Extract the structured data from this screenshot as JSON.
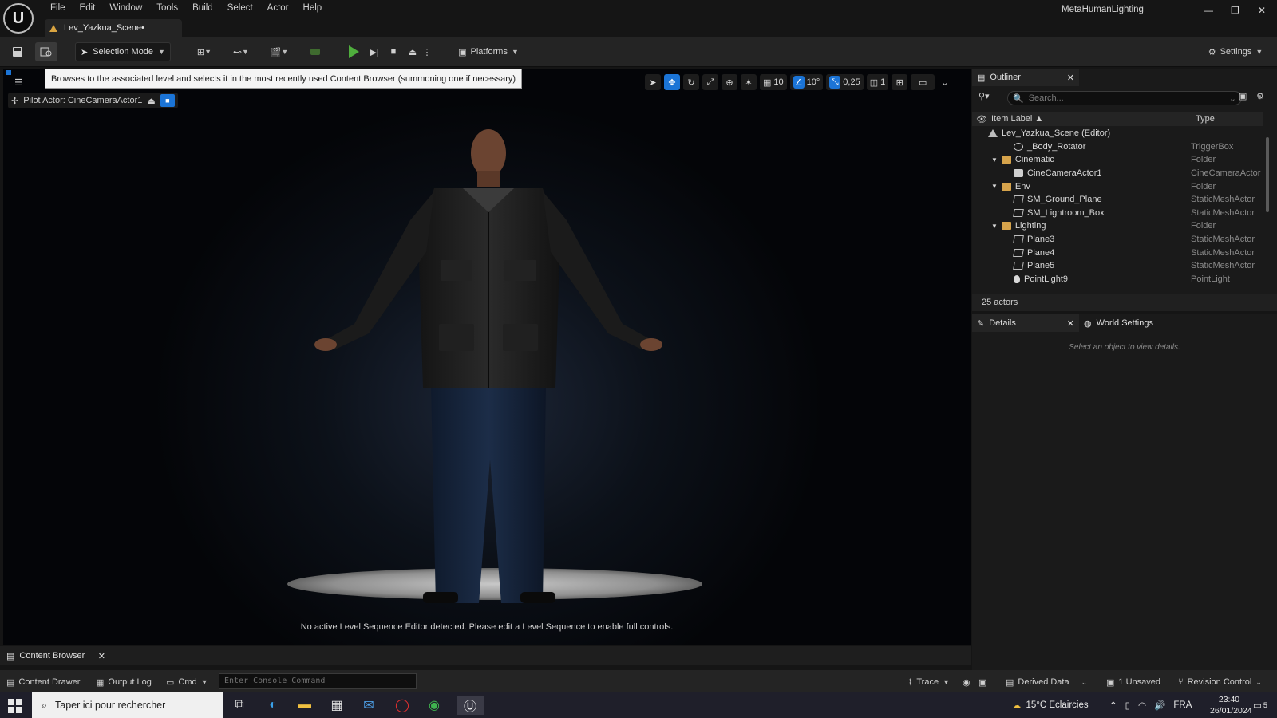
{
  "menu": [
    "File",
    "Edit",
    "Window",
    "Tools",
    "Build",
    "Select",
    "Actor",
    "Help"
  ],
  "document_tab": "Lev_Yazkua_Scene•",
  "app_title": "MetaHumanLighting",
  "toolbar": {
    "selection_mode": "Selection Mode",
    "platforms": "Platforms",
    "settings": "Settings"
  },
  "tooltip": "Browses to the associated level and selects it in the most recently used Content Browser (summoning one if necessary)",
  "viewport": {
    "pilot_actor": "Pilot Actor: CineCameraActor1",
    "grid_snap": "10",
    "rotation_snap": "10°",
    "scale_snap": "0,25",
    "camera_speed": "1",
    "message": "No active Level Sequence Editor detected. Please edit a Level Sequence to enable full controls."
  },
  "outliner": {
    "tab": "Outliner",
    "search_placeholder": "Search...",
    "col_label": "Item Label ▲",
    "col_type": "Type",
    "rows": [
      {
        "label": "Lev_Yazkua_Scene (Editor)",
        "type": "",
        "icon": "level-icon",
        "indent": 0
      },
      {
        "label": "_Body_Rotator",
        "type": "TriggerBox",
        "icon": "trigger-icon",
        "indent": 2
      },
      {
        "label": "Cinematic",
        "type": "Folder",
        "icon": "folder-icon",
        "indent": 1
      },
      {
        "label": "CineCameraActor1",
        "type": "CineCameraActor",
        "icon": "camera-icon",
        "indent": 2
      },
      {
        "label": "Env",
        "type": "Folder",
        "icon": "folder-icon",
        "indent": 1
      },
      {
        "label": "SM_Ground_Plane",
        "type": "StaticMeshActor",
        "icon": "mesh-icon",
        "indent": 2
      },
      {
        "label": "SM_Lightroom_Box",
        "type": "StaticMeshActor",
        "icon": "mesh-icon",
        "indent": 2
      },
      {
        "label": "Lighting",
        "type": "Folder",
        "icon": "folder-icon",
        "indent": 1
      },
      {
        "label": "Plane3",
        "type": "StaticMeshActor",
        "icon": "mesh-icon",
        "indent": 2
      },
      {
        "label": "Plane4",
        "type": "StaticMeshActor",
        "icon": "mesh-icon",
        "indent": 2
      },
      {
        "label": "Plane5",
        "type": "StaticMeshActor",
        "icon": "mesh-icon",
        "indent": 2
      },
      {
        "label": "PointLight9",
        "type": "PointLight",
        "icon": "pointlight-icon",
        "indent": 2
      }
    ],
    "actor_count": "25 actors"
  },
  "details": {
    "tab": "Details",
    "world_tab": "World Settings",
    "empty_msg": "Select an object to view details."
  },
  "bottom": {
    "content_browser": "Content Browser",
    "content_drawer": "Content Drawer",
    "output_log": "Output Log",
    "cmd": "Cmd",
    "console_placeholder": "Enter Console Command",
    "trace": "Trace",
    "derived_data": "Derived Data",
    "unsaved": "1 Unsaved",
    "revision": "Revision Control"
  },
  "taskbar": {
    "search": "Taper ici pour rechercher",
    "weather": "15°C  Eclaircies",
    "lang": "FRA",
    "time": "23:40",
    "date": "26/01/2024",
    "notif": "5"
  }
}
